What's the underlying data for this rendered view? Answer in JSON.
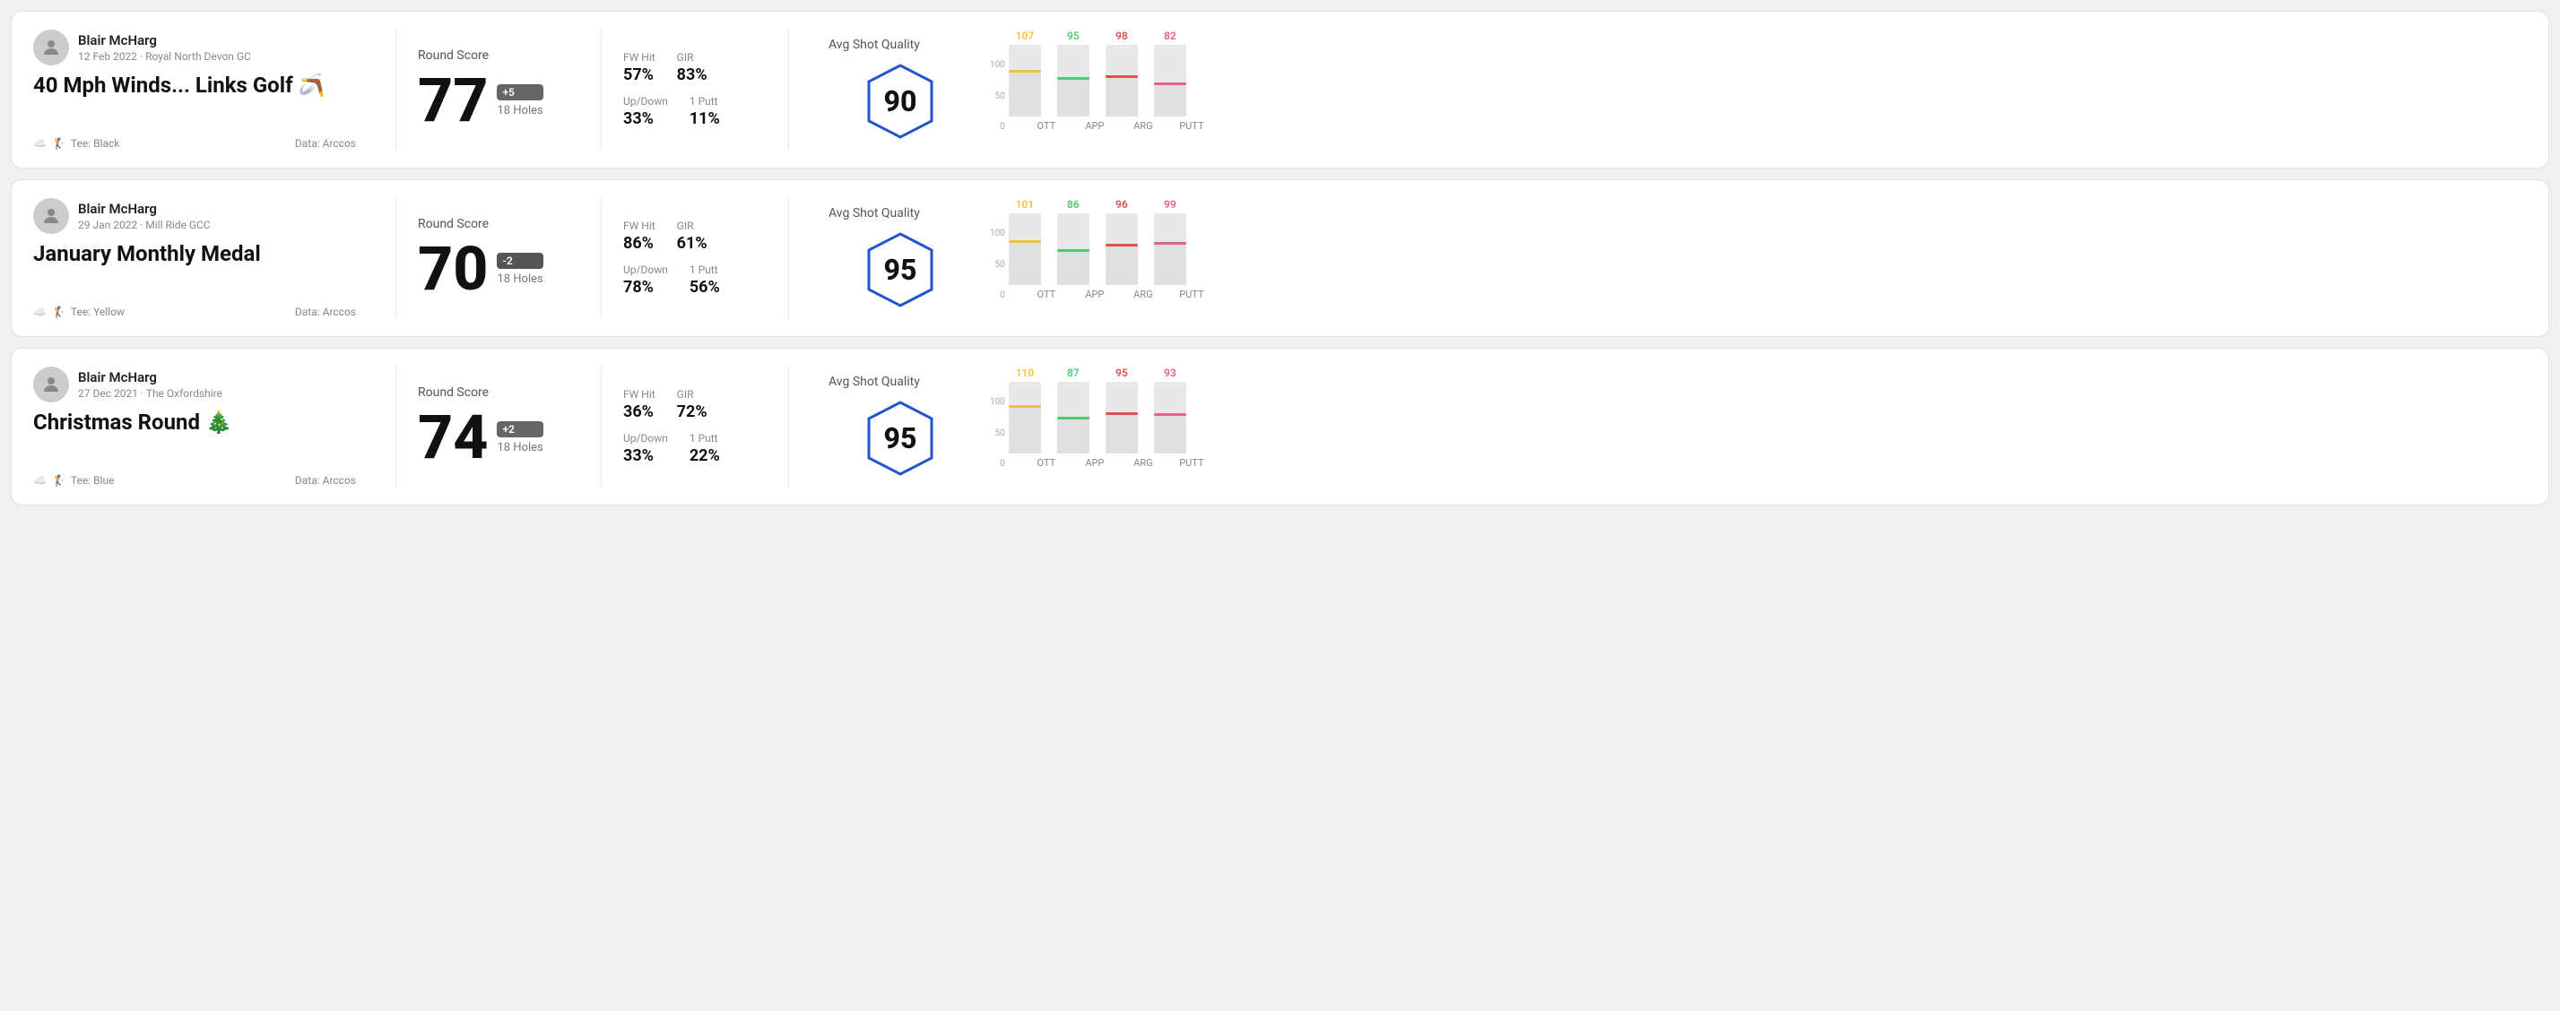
{
  "rounds": [
    {
      "id": "round1",
      "user": {
        "name": "Blair McHarg",
        "date_course": "12 Feb 2022 · Royal North Devon GC"
      },
      "title": "40 Mph Winds... Links Golf 🪃",
      "tee": "Black",
      "data_source": "Data: Arccos",
      "score": {
        "label": "Round Score",
        "number": "77",
        "badge": "+5",
        "holes": "18 Holes"
      },
      "stats": {
        "fw_hit_label": "FW Hit",
        "fw_hit_value": "57%",
        "gir_label": "GIR",
        "gir_value": "83%",
        "updown_label": "Up/Down",
        "updown_value": "33%",
        "oneputt_label": "1 Putt",
        "oneputt_value": "11%"
      },
      "quality": {
        "label": "Avg Shot Quality",
        "score": "90"
      },
      "chart": {
        "bars": [
          {
            "label": "OTT",
            "value": 107,
            "max": 120,
            "color": "#f0c040",
            "fill_pct": 65
          },
          {
            "label": "APP",
            "value": 95,
            "max": 120,
            "color": "#50c878",
            "fill_pct": 55
          },
          {
            "label": "ARG",
            "value": 98,
            "max": 120,
            "color": "#e05050",
            "fill_pct": 58
          },
          {
            "label": "PUTT",
            "value": 82,
            "max": 120,
            "color": "#e06090",
            "fill_pct": 48
          }
        ]
      }
    },
    {
      "id": "round2",
      "user": {
        "name": "Blair McHarg",
        "date_course": "29 Jan 2022 · Mill Ride GCC"
      },
      "title": "January Monthly Medal",
      "tee": "Yellow",
      "data_source": "Data: Arccos",
      "score": {
        "label": "Round Score",
        "number": "70",
        "badge": "-2",
        "holes": "18 Holes"
      },
      "stats": {
        "fw_hit_label": "FW Hit",
        "fw_hit_value": "86%",
        "gir_label": "GIR",
        "gir_value": "61%",
        "updown_label": "Up/Down",
        "updown_value": "78%",
        "oneputt_label": "1 Putt",
        "oneputt_value": "56%"
      },
      "quality": {
        "label": "Avg Shot Quality",
        "score": "95"
      },
      "chart": {
        "bars": [
          {
            "label": "OTT",
            "value": 101,
            "max": 120,
            "color": "#f0c040",
            "fill_pct": 62
          },
          {
            "label": "APP",
            "value": 86,
            "max": 120,
            "color": "#50c878",
            "fill_pct": 50
          },
          {
            "label": "ARG",
            "value": 96,
            "max": 120,
            "color": "#e05050",
            "fill_pct": 58
          },
          {
            "label": "PUTT",
            "value": 99,
            "max": 120,
            "color": "#e06090",
            "fill_pct": 60
          }
        ]
      }
    },
    {
      "id": "round3",
      "user": {
        "name": "Blair McHarg",
        "date_course": "27 Dec 2021 · The Oxfordshire"
      },
      "title": "Christmas Round 🎄",
      "tee": "Blue",
      "data_source": "Data: Arccos",
      "score": {
        "label": "Round Score",
        "number": "74",
        "badge": "+2",
        "holes": "18 Holes"
      },
      "stats": {
        "fw_hit_label": "FW Hit",
        "fw_hit_value": "36%",
        "gir_label": "GIR",
        "gir_value": "72%",
        "updown_label": "Up/Down",
        "updown_value": "33%",
        "oneputt_label": "1 Putt",
        "oneputt_value": "22%"
      },
      "quality": {
        "label": "Avg Shot Quality",
        "score": "95"
      },
      "chart": {
        "bars": [
          {
            "label": "OTT",
            "value": 110,
            "max": 120,
            "color": "#f0c040",
            "fill_pct": 68
          },
          {
            "label": "APP",
            "value": 87,
            "max": 120,
            "color": "#50c878",
            "fill_pct": 51
          },
          {
            "label": "ARG",
            "value": 95,
            "max": 120,
            "color": "#e05050",
            "fill_pct": 57
          },
          {
            "label": "PUTT",
            "value": 93,
            "max": 120,
            "color": "#e06090",
            "fill_pct": 56
          }
        ]
      }
    }
  ],
  "chart_y_labels": [
    "100",
    "50",
    "0"
  ]
}
